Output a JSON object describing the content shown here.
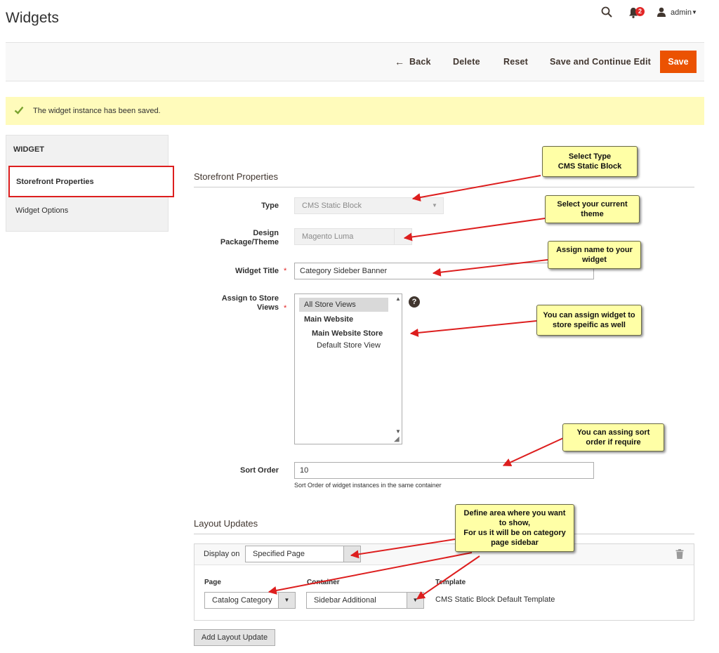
{
  "header": {
    "title": "Widgets",
    "notifications_count": "2",
    "user": "admin",
    "icons": [
      "search-icon",
      "bell-icon",
      "user-icon",
      "caret-down-icon"
    ]
  },
  "actions": {
    "back": "Back",
    "delete": "Delete",
    "reset": "Reset",
    "save_continue": "Save and Continue Edit",
    "save": "Save"
  },
  "message": {
    "text": "The widget instance has been saved."
  },
  "tabs": {
    "title": "WIDGET",
    "items": [
      {
        "label": "Storefront Properties",
        "active": true
      },
      {
        "label": "Widget Options",
        "active": false
      }
    ]
  },
  "form": {
    "section_title": "Storefront Properties",
    "type": {
      "label": "Type",
      "value": "CMS Static Block"
    },
    "theme": {
      "label": "Design Package/Theme",
      "value": "Magento Luma"
    },
    "widget_title": {
      "label": "Widget Title",
      "value": "Category Sideber Banner"
    },
    "store_views": {
      "label": "Assign to Store Views",
      "items": [
        "All Store Views",
        "Main Website",
        "Main Website Store",
        "Default Store View"
      ],
      "help": "?"
    },
    "sort_order": {
      "label": "Sort Order",
      "value": "10",
      "note": "Sort Order of widget instances in the same container"
    }
  },
  "layout_updates": {
    "title": "Layout Updates",
    "display_on_label": "Display on",
    "display_on_value": "Specified Page",
    "page_label": "Page",
    "page_value": "Catalog Category",
    "container_label": "Container",
    "container_value": "Sidebar Additional",
    "template_label": "Template",
    "template_value": "CMS Static Block Default Template",
    "add_button": "Add Layout Update"
  },
  "callouts": {
    "type_line1": "Select Type",
    "type_line2": "CMS Static Block",
    "theme": "Select your current theme",
    "name": "Assign name to your widget",
    "store": "You can assign widget to store speific as well",
    "sort": "You can assing sort order if require",
    "area_line1": "Define area where you want to show,",
    "area_line2": "For us it will be on category page sidebar"
  },
  "colors": {
    "accent": "#eb5202",
    "highlight_border": "#dd1e1e",
    "message_bg": "#fffbbb",
    "callout_bg": "#ffffa6",
    "arrow": "#dd1e1e"
  }
}
